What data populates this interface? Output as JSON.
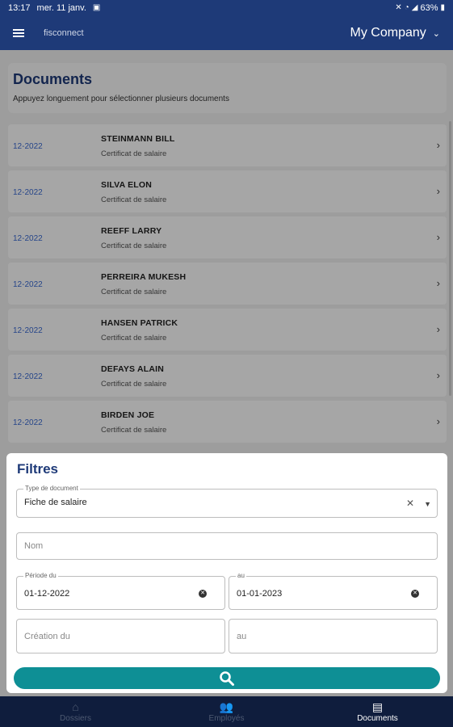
{
  "status_bar": {
    "time": "13:17",
    "date": "mer. 11 janv.",
    "battery": "63%"
  },
  "app_bar": {
    "title": "fisconnect",
    "company": "My Company"
  },
  "header": {
    "title": "Documents",
    "subtitle": "Appuyez longuement pour sélectionner plusieurs documents"
  },
  "documents": [
    {
      "date": "12-2022",
      "name": "STEINMANN BILL",
      "type": "Certificat de salaire"
    },
    {
      "date": "12-2022",
      "name": "SILVA ELON",
      "type": "Certificat de salaire"
    },
    {
      "date": "12-2022",
      "name": "REEFF LARRY",
      "type": "Certificat de salaire"
    },
    {
      "date": "12-2022",
      "name": "PERREIRA MUKESH",
      "type": "Certificat de salaire"
    },
    {
      "date": "12-2022",
      "name": "HANSEN PATRICK",
      "type": "Certificat de salaire"
    },
    {
      "date": "12-2022",
      "name": "DEFAYS ALAIN",
      "type": "Certificat de salaire"
    },
    {
      "date": "12-2022",
      "name": "BIRDEN JOE",
      "type": "Certificat de salaire"
    }
  ],
  "filters": {
    "title": "Filtres",
    "doc_type": {
      "label": "Type de document",
      "value": "Fiche de salaire"
    },
    "name": {
      "placeholder": "Nom"
    },
    "period_from": {
      "label": "Période du",
      "value": "01-12-2022"
    },
    "period_to": {
      "label": "au",
      "value": "01-01-2023"
    },
    "created_from": {
      "placeholder": "Création du"
    },
    "created_to": {
      "placeholder": "au"
    }
  },
  "bottom_nav": [
    {
      "label": "Dossiers",
      "icon": "home-icon",
      "active": false
    },
    {
      "label": "Employés",
      "icon": "people-icon",
      "active": false
    },
    {
      "label": "Documents",
      "icon": "documents-icon",
      "active": true
    }
  ],
  "colors": {
    "primary": "#1e3a78",
    "accent": "#0e8f95",
    "link": "#3b6bd3"
  }
}
